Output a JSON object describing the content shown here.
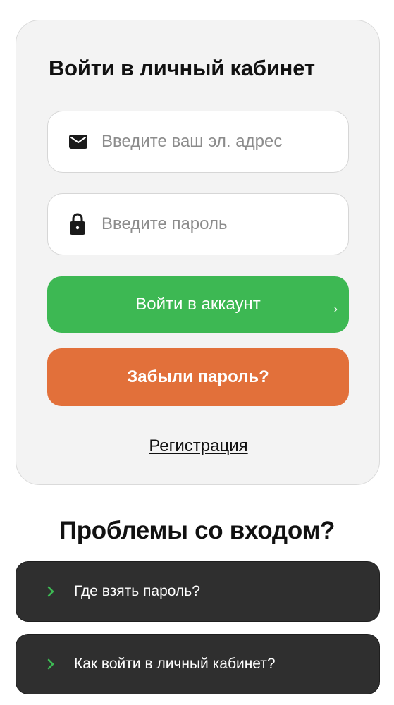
{
  "login": {
    "title": "Войти в личный кабинет",
    "email_placeholder": "Введите ваш эл. адрес",
    "email_value": "",
    "password_placeholder": "Введите пароль",
    "password_value": "",
    "login_button": "Войти в аккаунт",
    "login_chevron": "›",
    "forgot_button": "Забыли пароль?",
    "register_link": "Регистрация"
  },
  "help": {
    "title": "Проблемы со входом?",
    "items": [
      {
        "label": "Где взять пароль?"
      },
      {
        "label": "Как войти в личный кабинет?"
      }
    ]
  },
  "icons": {
    "email": "envelope-icon",
    "password": "lock-icon",
    "faq": "chevron-right-icon"
  },
  "colors": {
    "card_background": "#f3f3f3",
    "login_button": "#3db853",
    "forgot_button": "#e2703a",
    "faq_background": "#2f2f2f",
    "faq_chevron": "#3db853"
  }
}
